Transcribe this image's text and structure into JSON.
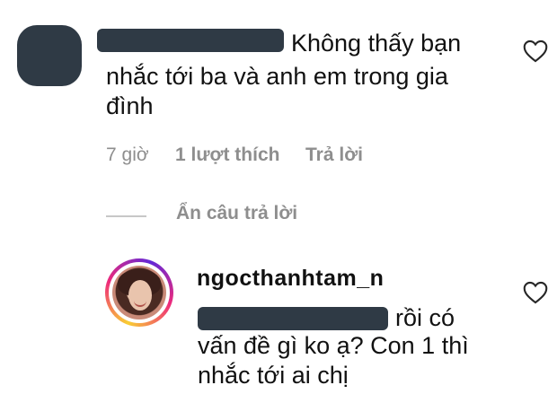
{
  "comment": {
    "text_lines": [
      "Không thấy bạn",
      "nhắc tới ba và anh em trong gia",
      "đình"
    ],
    "time": "7 giờ",
    "likes": "1 lượt thích",
    "reply_label": "Trả lời"
  },
  "thread": {
    "hide_replies_label": "Ẩn câu trả lời"
  },
  "reply": {
    "username": "ngocthanhtam_n",
    "text_lines": [
      "rồi có",
      "vấn đề gì ko ạ? Con 1 thì",
      "nhắc tới ai chị"
    ]
  },
  "colors": {
    "redaction": "#2f3a45",
    "meta_text": "#8e8e8e",
    "story_ring": [
      "#f9ce34",
      "#ee2a7b",
      "#6228d7"
    ]
  },
  "icons": {
    "like": "heart-outline-icon"
  }
}
